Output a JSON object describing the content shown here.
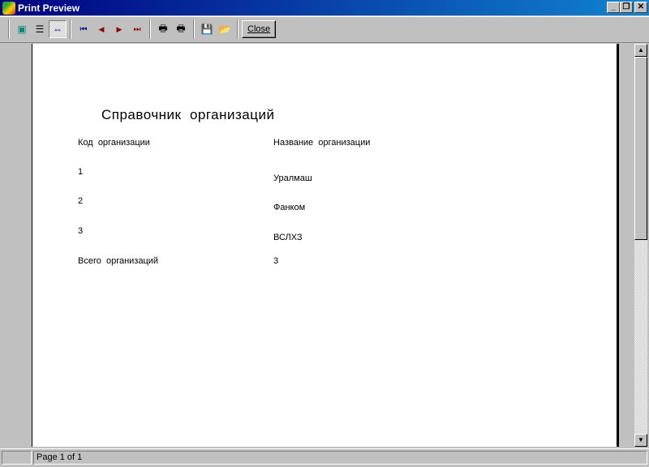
{
  "window": {
    "title": "Print Preview",
    "minimize": "_",
    "restore": "❐",
    "close": "✕"
  },
  "toolbar": {
    "buttons": [
      {
        "name": "one-page",
        "icon": "▣"
      },
      {
        "name": "page-width",
        "icon": "☰"
      },
      {
        "name": "zoom-fit",
        "icon": "⇔"
      },
      {
        "name": "first-page",
        "icon": "⏮"
      },
      {
        "name": "prev-page",
        "icon": "◀"
      },
      {
        "name": "next-page",
        "icon": "▶"
      },
      {
        "name": "last-page",
        "icon": "⏭"
      },
      {
        "name": "print-setup",
        "icon": "🖶"
      },
      {
        "name": "print",
        "icon": "🖶"
      },
      {
        "name": "save",
        "icon": "💾"
      },
      {
        "name": "open",
        "icon": "📂"
      }
    ],
    "close_label": "Close"
  },
  "report": {
    "title": "Справочник  организаций",
    "col1_header": "Код  организации",
    "col2_header": "Название  организации",
    "rows": [
      {
        "code": "1",
        "name": "Уралмаш"
      },
      {
        "code": "2",
        "name": "Фанком"
      },
      {
        "code": "3",
        "name": "ВСЛХЗ"
      }
    ],
    "total_label": "Всего  организаций",
    "total_value": "3"
  },
  "status": {
    "page": "Page 1 of 1"
  }
}
